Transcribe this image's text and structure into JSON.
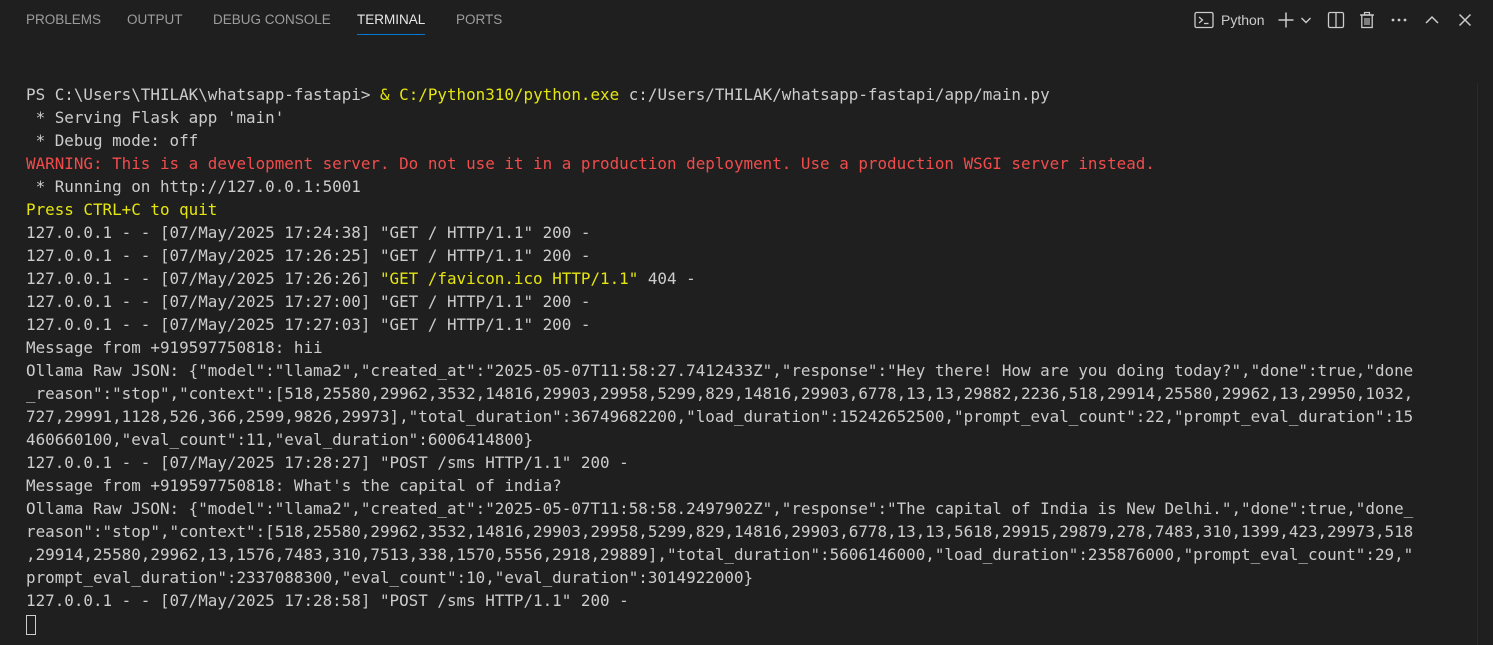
{
  "tabs": [
    {
      "label": "PROBLEMS"
    },
    {
      "label": "OUTPUT"
    },
    {
      "label": "DEBUG CONSOLE"
    },
    {
      "label": "TERMINAL"
    },
    {
      "label": "PORTS"
    }
  ],
  "active_tab": "TERMINAL",
  "toolbar": {
    "profile_label": "Python",
    "icons": [
      "terminal-icon",
      "plus-icon",
      "chevron-down-icon",
      "split-icon",
      "trash-icon",
      "more-icon",
      "chevron-up-icon",
      "close-icon"
    ]
  },
  "colors": {
    "background": "#1f1f1f",
    "text": "#cccccc",
    "warning": "#f14c4c",
    "highlight": "#e5e510",
    "tab_underline": "#0078d4"
  },
  "terminal": {
    "prompt": "PS C:\\Users\\THILAK\\whatsapp-fastapi> ",
    "cmd_amp": "& ",
    "cmd_python": "C:/Python310/python.exe",
    "cmd_arg": " c:/Users/THILAK/whatsapp-fastapi/app/main.py",
    "lines": [
      " * Serving Flask app 'main'",
      " * Debug mode: off",
      "WARNING: This is a development server. Do not use it in a production deployment. Use a production WSGI server instead.",
      " * Running on http://127.0.0.1:5001",
      "Press CTRL+C to quit",
      "127.0.0.1 - - [07/May/2025 17:24:38] \"GET / HTTP/1.1\" 200 -",
      "127.0.0.1 - - [07/May/2025 17:26:25] \"GET / HTTP/1.1\" 200 -"
    ],
    "favicon_prefix": "127.0.0.1 - - [07/May/2025 17:26:26] ",
    "favicon_request": "\"GET /favicon.ico HTTP/1.1\"",
    "favicon_suffix": " 404 -",
    "lines2": [
      "127.0.0.1 - - [07/May/2025 17:27:00] \"GET / HTTP/1.1\" 200 -",
      "127.0.0.1 - - [07/May/2025 17:27:03] \"GET / HTTP/1.1\" 200 -",
      "Message from +919597750818: hii",
      "Ollama Raw JSON: {\"model\":\"llama2\",\"created_at\":\"2025-05-07T11:58:27.7412433Z\",\"response\":\"Hey there! How are you doing today?\",\"done\":true,\"done",
      "_reason\":\"stop\",\"context\":[518,25580,29962,3532,14816,29903,29958,5299,829,14816,29903,6778,13,13,29882,2236,518,29914,25580,29962,13,29950,1032,",
      "727,29991,1128,526,366,2599,9826,29973],\"total_duration\":36749682200,\"load_duration\":15242652500,\"prompt_eval_count\":22,\"prompt_eval_duration\":15",
      "460660100,\"eval_count\":11,\"eval_duration\":6006414800}",
      "127.0.0.1 - - [07/May/2025 17:28:27] \"POST /sms HTTP/1.1\" 200 -",
      "Message from +919597750818: What's the capital of india?",
      "Ollama Raw JSON: {\"model\":\"llama2\",\"created_at\":\"2025-05-07T11:58:58.2497902Z\",\"response\":\"The capital of India is New Delhi.\",\"done\":true,\"done_",
      "reason\":\"stop\",\"context\":[518,25580,29962,3532,14816,29903,29958,5299,829,14816,29903,6778,13,13,5618,29915,29879,278,7483,310,1399,423,29973,518",
      ",29914,25580,29962,13,1576,7483,310,7513,338,1570,5556,2918,29889],\"total_duration\":5606146000,\"load_duration\":235876000,\"prompt_eval_count\":29,\"",
      "prompt_eval_duration\":2337088300,\"eval_count\":10,\"eval_duration\":3014922000}",
      "127.0.0.1 - - [07/May/2025 17:28:58] \"POST /sms HTTP/1.1\" 200 -"
    ]
  }
}
